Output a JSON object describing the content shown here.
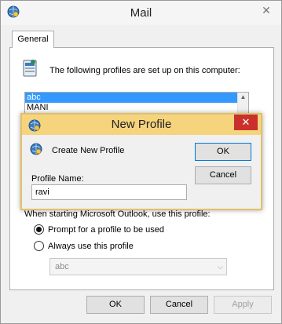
{
  "mail_window": {
    "title": "Mail",
    "close_glyph": "✕",
    "tab_general": "General",
    "profiles_text": "The following profiles are set up on this computer:",
    "profiles": [
      "abc",
      "MANI"
    ],
    "startup_text": "When starting Microsoft Outlook, use this profile:",
    "radio_prompt": "Prompt for a profile to be used",
    "radio_always": "Always use this profile",
    "selected_profile": "abc",
    "ok_label": "OK",
    "cancel_label": "Cancel",
    "apply_label": "Apply"
  },
  "new_profile_dialog": {
    "title": "New Profile",
    "close_glyph": "✕",
    "create_text": "Create New Profile",
    "name_label": "Profile Name:",
    "name_value": "ravi",
    "ok_label": "OK",
    "cancel_label": "Cancel"
  },
  "icons": {
    "app": "mail-globe-icon",
    "profiles": "profiles-envelope-icon",
    "dialog": "new-profile-globe-icon"
  },
  "colors": {
    "dialog_title": "#f6d37d",
    "dialog_border": "#e2c069",
    "close_red": "#c9302c",
    "selection": "#3399ff"
  }
}
